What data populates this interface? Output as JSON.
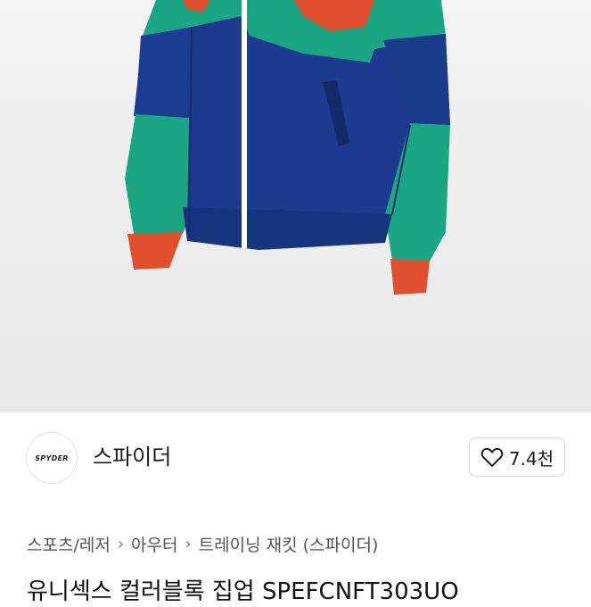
{
  "product_image": {
    "alt": "",
    "colors": {
      "navy": "#1c3b8f",
      "teal": "#1aa583",
      "orange": "#e0502f",
      "zipper": "#ffffff"
    }
  },
  "seller": {
    "logo_text": "SPYDER",
    "name": "스파이더"
  },
  "like": {
    "icon": "heart-outline-icon",
    "count": "7.4천"
  },
  "breadcrumb": {
    "items": [
      "스포츠/레저",
      "아우터",
      "트레이닝 재킷 (스파이더)"
    ],
    "separator_icon": "chevron-right-icon"
  },
  "product": {
    "title": "유니섹스 컬러블록 집업 SPEFCNFT303UO"
  }
}
